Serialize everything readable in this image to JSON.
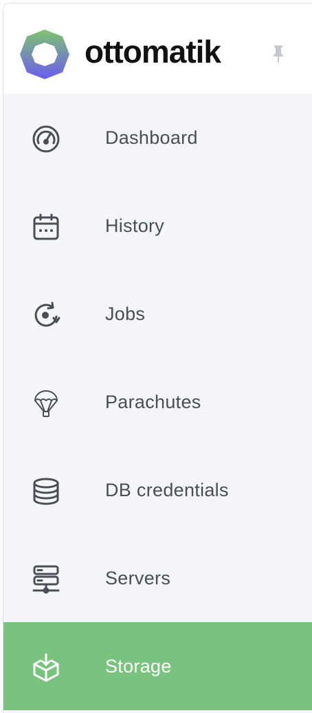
{
  "brand": {
    "name": "ottomatik",
    "logo_gradient_top": "#7ec56f",
    "logo_gradient_bottom": "#6a5cf0"
  },
  "colors": {
    "sidebar_bg": "#f4f5f9",
    "active_bg": "#79c37e",
    "text": "#4a4d55",
    "icon": "#4a4d55"
  },
  "nav": {
    "items": [
      {
        "label": "Dashboard",
        "icon": "gauge-icon",
        "active": false
      },
      {
        "label": "History",
        "icon": "calendar-icon",
        "active": false
      },
      {
        "label": "Jobs",
        "icon": "refresh-cycle-icon",
        "active": false
      },
      {
        "label": "Parachutes",
        "icon": "parachute-icon",
        "active": false
      },
      {
        "label": "DB credentials",
        "icon": "database-icon",
        "active": false
      },
      {
        "label": "Servers",
        "icon": "server-icon",
        "active": false
      },
      {
        "label": "Storage",
        "icon": "storage-box-icon",
        "active": true
      }
    ]
  }
}
